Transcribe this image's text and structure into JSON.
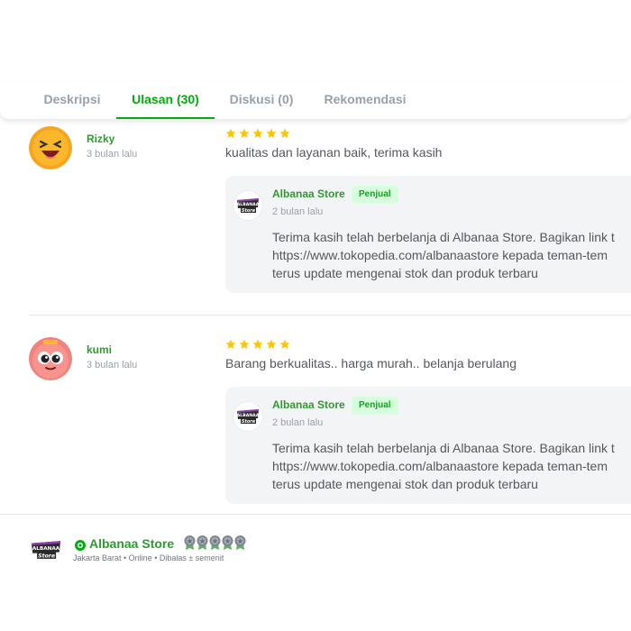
{
  "tabs": [
    {
      "label": "Deskripsi",
      "active": false
    },
    {
      "label": "Ulasan (30)",
      "active": true
    },
    {
      "label": "Diskusi (0)",
      "active": false
    },
    {
      "label": "Rekomendasi",
      "active": false
    }
  ],
  "reviews": [
    {
      "name": "Rizky",
      "time": "3 bulan lalu",
      "rating": 5,
      "text": "kualitas dan layanan baik, terima kasih",
      "reply": {
        "seller": "Albanaa Store",
        "badge": "Penjual",
        "time": "2 bulan lalu",
        "lines": [
          "Terima kasih telah berbelanja di Albanaa Store. Bagikan link t",
          "https://www.tokopedia.com/albanaastore kepada teman-tem",
          "terus update mengenai stok dan produk terbaru"
        ]
      }
    },
    {
      "name": "kumi",
      "time": "3 bulan lalu",
      "rating": 5,
      "text": "Barang berkualitas.. harga murah.. belanja berulang",
      "reply": {
        "seller": "Albanaa Store",
        "badge": "Penjual",
        "time": "2 bulan lalu",
        "lines": [
          "Terima kasih telah berbelanja di Albanaa Store. Bagikan link t",
          "https://www.tokopedia.com/albanaastore kepada teman-tem",
          "terus update mengenai stok dan produk terbaru"
        ]
      }
    }
  ],
  "shop": {
    "name": "Albanaa Store",
    "meta": "Jakarta Barat • Online • Dibalas ± semenit",
    "medal_count": 5,
    "logo_text_top": "ALBANAA",
    "logo_text_bottom": "Store"
  },
  "colors": {
    "accent": "#03ac0e",
    "name_green": "#2e9b2f",
    "star": "#ffc400",
    "reply_bg": "#f3f4f5"
  },
  "icons": {
    "star": "star-icon",
    "verified": "verified-shop-icon",
    "medal": "medal-icon"
  }
}
